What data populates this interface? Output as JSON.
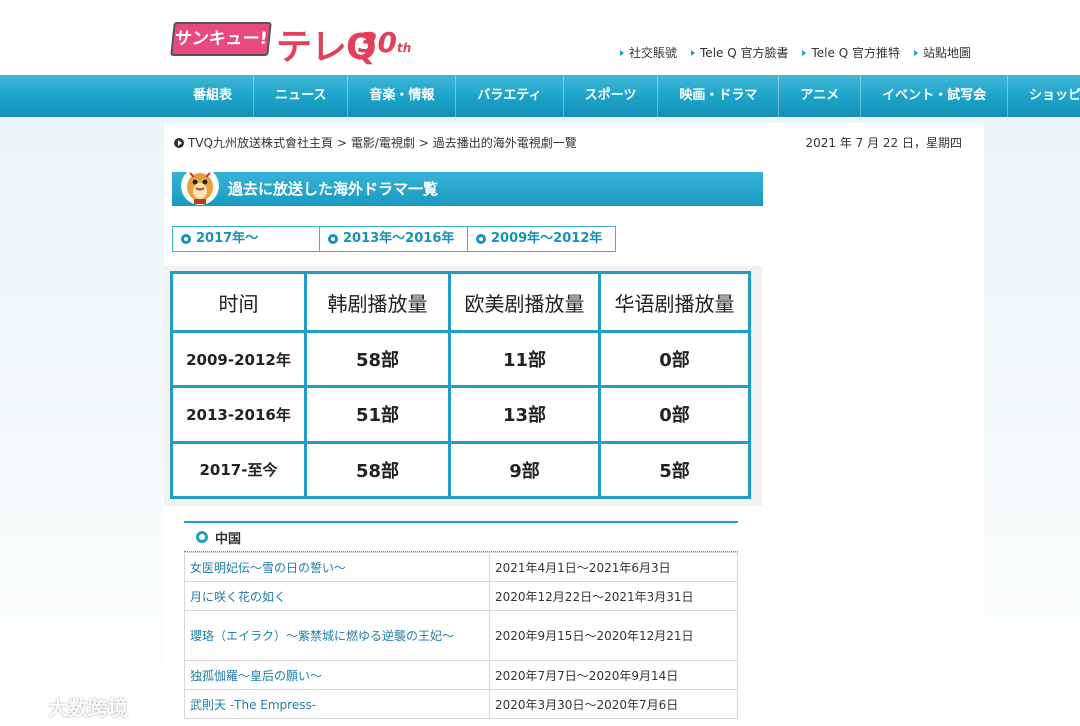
{
  "logo": {
    "brand_badge": "サンキュー!",
    "brand_text": "テレQ",
    "anniversary": "30",
    "anniversary_suffix": "th"
  },
  "top_links": [
    "社交賬號",
    "Tele Q 官方臉書",
    "Tele Q 官方推特",
    "站點地圖"
  ],
  "nav": [
    "番組表",
    "ニュース",
    "音楽・情報",
    "バラエティ",
    "スポーツ",
    "映画・ドラマ",
    "アニメ",
    "イベント・試写会",
    "ショッピング"
  ],
  "breadcrumb": [
    "TVQ九州放送株式會社主頁",
    "> 電影/電視劇",
    "> 過去播出的海外電視劇一覽"
  ],
  "date": "2021 年 7 月 22 日，星期四",
  "section_title": "過去に放送した海外ドラマ一覧",
  "tabs": [
    "2017年～",
    "2013年～2016年",
    "2009年～2012年"
  ],
  "stats": {
    "headers": [
      "时间",
      "韩剧播放量",
      "欧美剧播放量",
      "华语剧播放量"
    ],
    "rows": [
      [
        "2009-2012年",
        "58部",
        "11部",
        "0部"
      ],
      [
        "2013-2016年",
        "51部",
        "13部",
        "0部"
      ],
      [
        "2017-至今",
        "58部",
        "9部",
        "5部"
      ]
    ]
  },
  "china": {
    "heading": "中国",
    "rows": [
      {
        "title": "女医明妃伝～雪の日の誓い～",
        "period": "2021年4月1日～2021年6月3日"
      },
      {
        "title": "月に咲く花の如く",
        "period": "2020年12月22日～2021年3月31日"
      },
      {
        "title": "瓔珞（エイラク）～紫禁城に燃ゆる逆襲の王妃～",
        "period": "2020年9月15日～2020年12月21日"
      },
      {
        "title": "独孤伽羅～皇后の願い～",
        "period": "2020年7月7日～2020年9月14日"
      },
      {
        "title": "武則天 -The Empress-",
        "period": "2020年3月30日～2020年7月6日"
      }
    ]
  },
  "watermark": "大数跨境",
  "colors": {
    "accent": "#1f9fc4",
    "logo_red": "#e2405a",
    "logo_pink": "#e84a7f"
  }
}
